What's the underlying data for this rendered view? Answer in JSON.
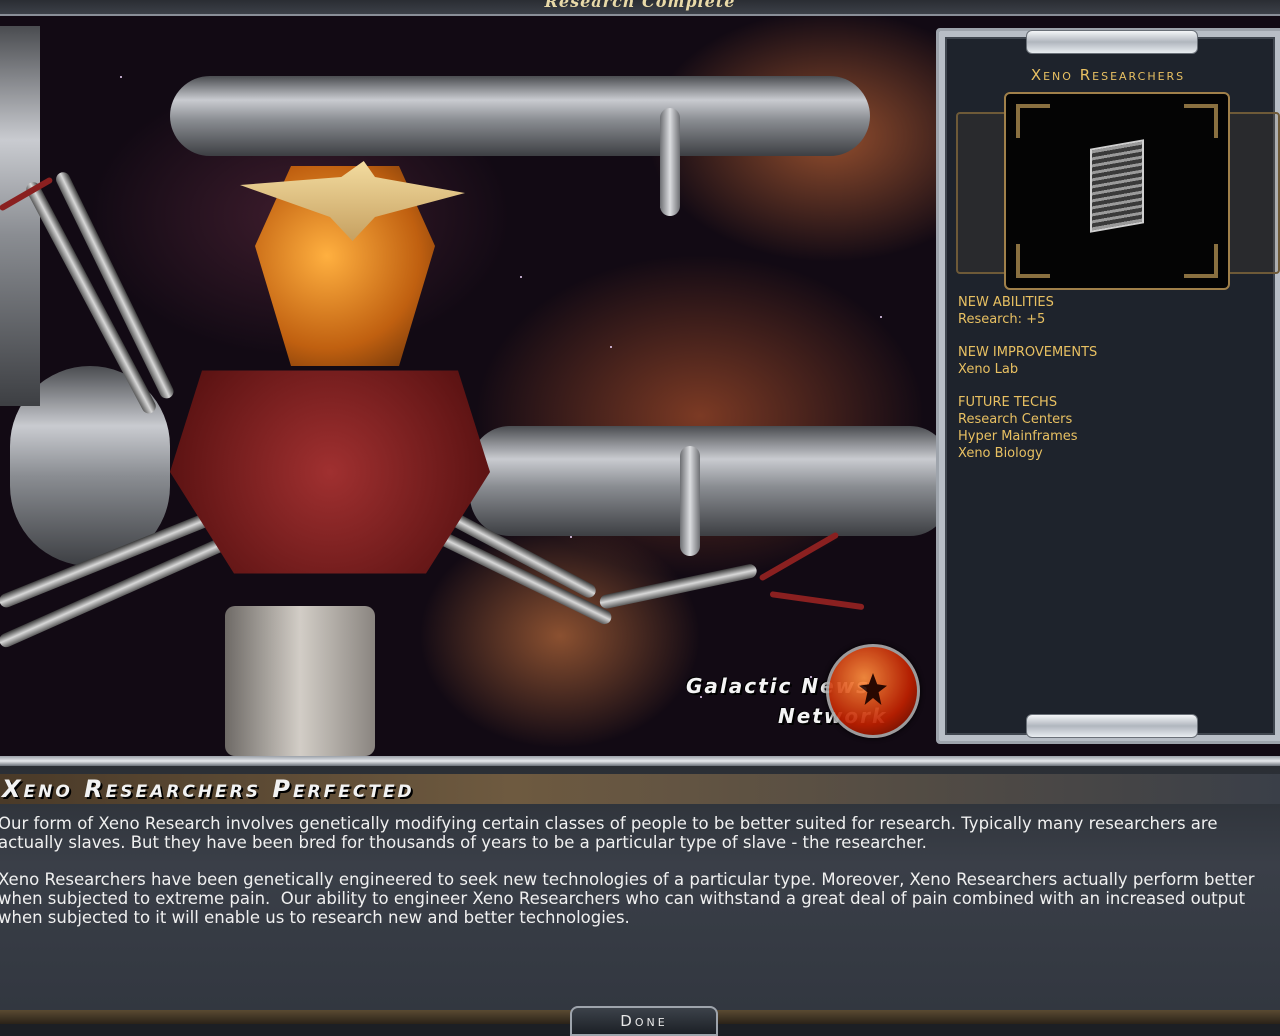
{
  "window": {
    "title": "Research Complete"
  },
  "panel": {
    "title": "Xeno Researchers",
    "new_abilities_label": "NEW ABILITIES",
    "new_abilities": [
      "Research: +5"
    ],
    "new_improvements_label": "NEW IMPROVEMENTS",
    "new_improvements": [
      "Xeno Lab"
    ],
    "future_techs_label": "FUTURE TECHS",
    "future_techs": [
      "Research Centers",
      "Hyper Mainframes",
      "Xeno Biology"
    ]
  },
  "logo": {
    "line1": "Galactic News",
    "line2": "Network"
  },
  "headline": "Xeno Researchers Perfected",
  "description": {
    "paragraph1": "Our form of Xeno Research involves genetically modifying certain classes of people to be better suited for research. Typically many researchers are actually slaves. But they have been bred for thousands of years to be a particular type of slave - the researcher.",
    "paragraph2": "Xeno Researchers have been genetically engineered to seek new technologies of a particular type. Moreover, Xeno Researchers actually perform better when subjected to extreme pain.  Our ability to engineer Xeno Researchers who can withstand a great deal of pain combined with an increased output when subjected to it will enable us to research new and better technologies."
  },
  "buttons": {
    "done": "Done"
  },
  "colors": {
    "accent": "#e8c062",
    "panel_bg": "#1e232c",
    "frame": "#9ea4ac"
  }
}
